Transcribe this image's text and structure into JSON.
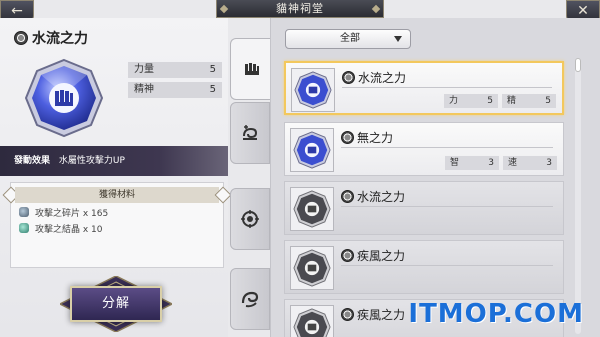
{
  "window": {
    "title": "貓神祠堂",
    "back_label": "←",
    "close_label": "✕"
  },
  "detail": {
    "name": "水流之力",
    "stats": [
      {
        "label": "力量",
        "value": "5"
      },
      {
        "label": "精神",
        "value": "5"
      }
    ],
    "effect_label": "發動效果",
    "effect_text": "水屬性攻擊力UP",
    "materials_title": "獲得材料",
    "materials": [
      {
        "icon": "shard-icon",
        "text": "攻擊之碎片 x 165"
      },
      {
        "icon": "crystal-icon",
        "text": "攻擊之結晶 x 10"
      }
    ],
    "decompose_label": "分解"
  },
  "filter": {
    "selected": "全部"
  },
  "tabs": [
    {
      "name": "fist-tab",
      "active": true
    },
    {
      "name": "swirl-plus-tab",
      "active": false
    },
    {
      "name": "sun-emblem-tab",
      "active": false
    },
    {
      "name": "wave-tab",
      "active": false
    }
  ],
  "cards": [
    {
      "name": "水流之力",
      "gem": "blue",
      "stats": [
        {
          "l": "力",
          "v": "5"
        },
        {
          "l": "精",
          "v": "5"
        }
      ]
    },
    {
      "name": "無之力",
      "gem": "blue",
      "stats": [
        {
          "l": "智",
          "v": "3"
        },
        {
          "l": "速",
          "v": "3"
        }
      ]
    },
    {
      "name": "水流之力",
      "gem": "gray",
      "stats": []
    },
    {
      "name": "疾風之力",
      "gem": "gray",
      "stats": []
    },
    {
      "name": "疾風之力",
      "gem": "gray",
      "stats": []
    }
  ],
  "watermark": "ITMOP.COM",
  "colors": {
    "accent_gold": "#f3c85d",
    "gem_blue": "#3b4ed0",
    "effect_bar": "#2e2a3e",
    "watermark": "#1b6fd8"
  }
}
